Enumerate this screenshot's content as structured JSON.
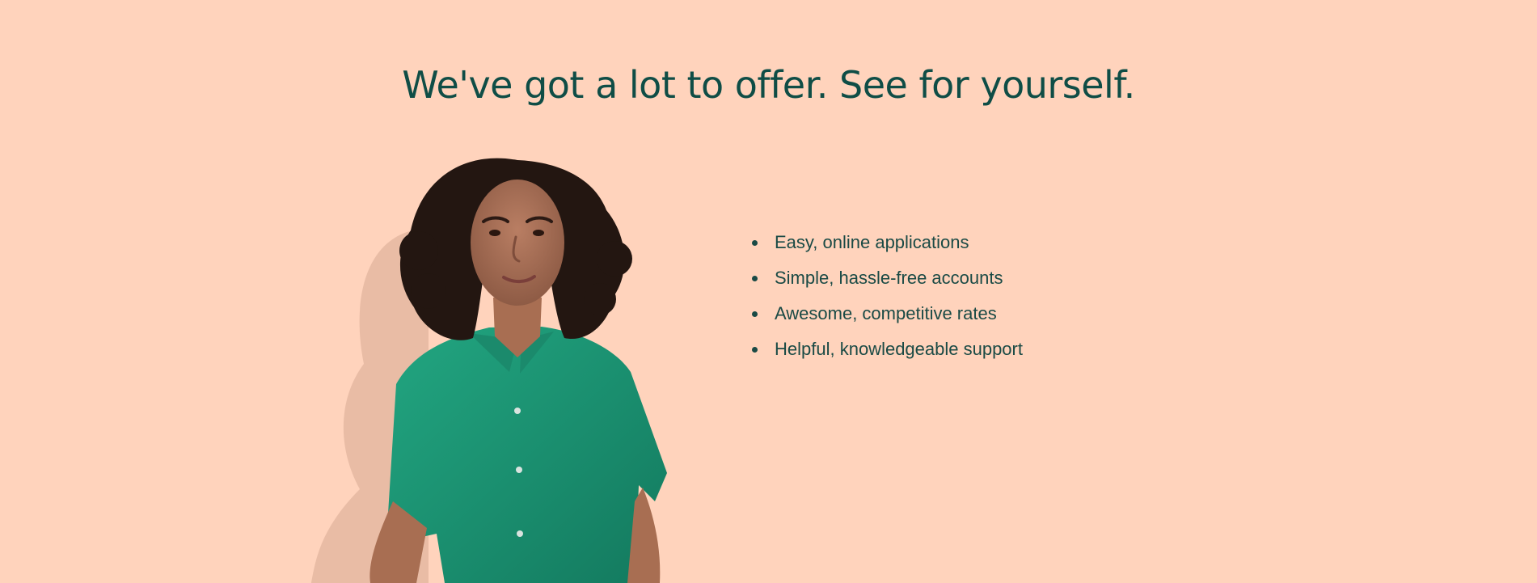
{
  "hero": {
    "headline": "We've got a lot to offer. See for yourself.",
    "background_color": "#FFD3BC",
    "text_color": "#0F4D46",
    "photo": {
      "subject": "smiling woman with curly hair in a green shirt",
      "shirt_color": "#1A9A76"
    }
  },
  "benefits": [
    {
      "label": "Easy, online applications"
    },
    {
      "label": "Simple, hassle-free accounts"
    },
    {
      "label": "Awesome, competitive rates"
    },
    {
      "label": "Helpful, knowledgeable support"
    }
  ]
}
